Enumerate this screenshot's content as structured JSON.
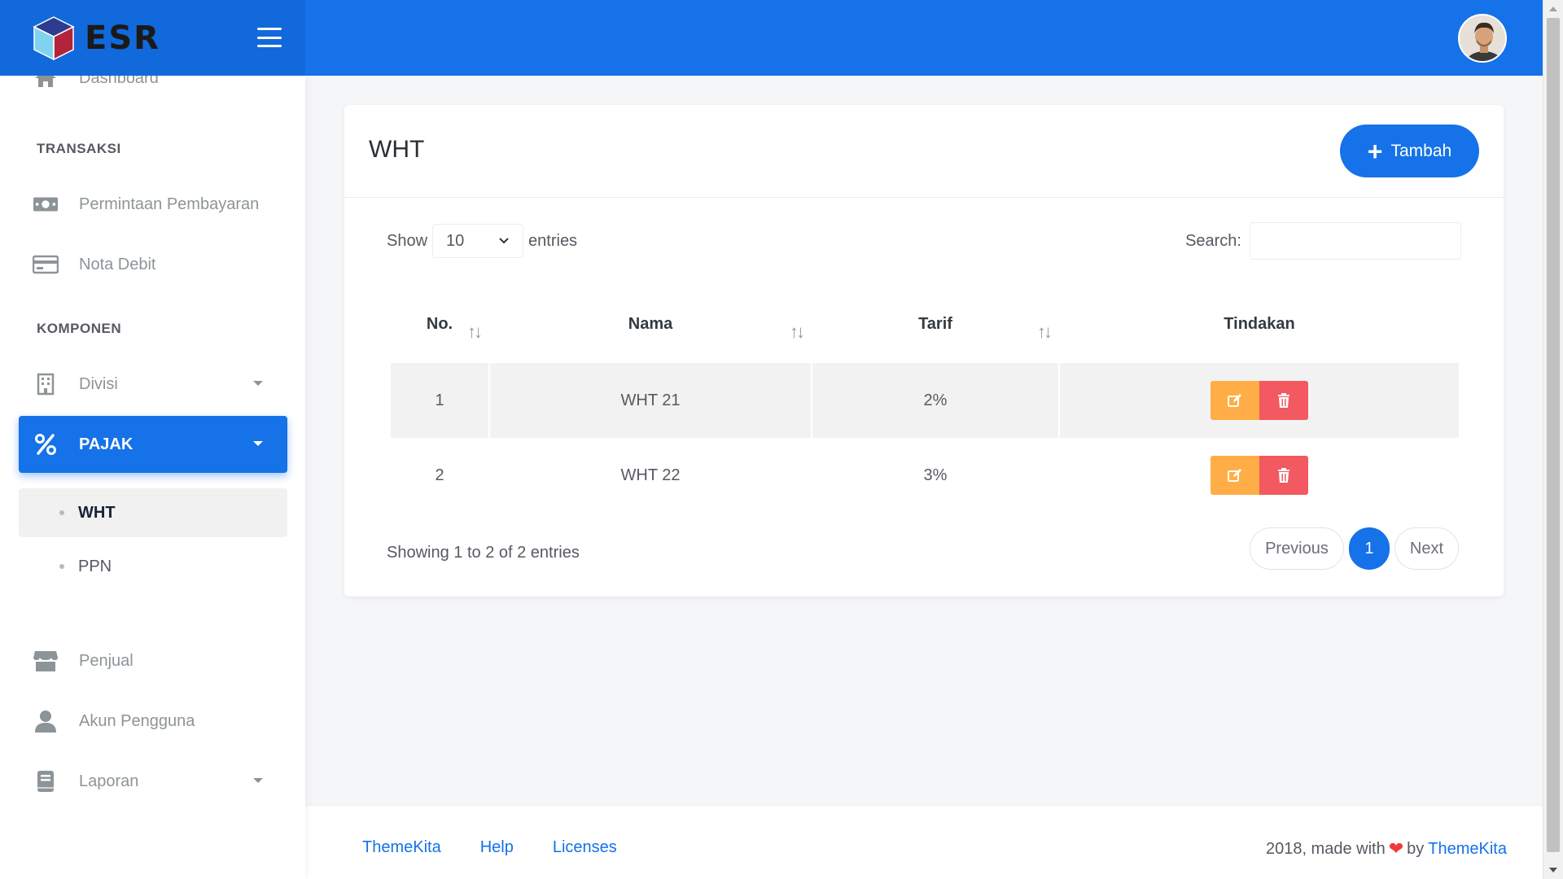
{
  "brand": {
    "name": "ESR"
  },
  "sidebar": {
    "dashboard": "Dashboard",
    "section_transaksi": "TRANSAKSI",
    "permintaan": "Permintaan Pembayaran",
    "nota_debit": "Nota Debit",
    "section_komponen": "KOMPONEN",
    "divisi": "Divisi",
    "pajak": "PAJAK",
    "pajak_sub": [
      "WHT",
      "PPN"
    ],
    "penjual": "Penjual",
    "akun": "Akun Pengguna",
    "laporan": "Laporan"
  },
  "page": {
    "title": "WHT",
    "add_button": "Tambah",
    "show_label": "Show",
    "entries_value": "10",
    "entries_label": "entries",
    "search_label": "Search:",
    "search_value": ""
  },
  "table": {
    "headers": [
      "No.",
      "Nama",
      "Tarif",
      "Tindakan"
    ],
    "rows": [
      {
        "no": "1",
        "nama": "WHT 21",
        "tarif": "2%"
      },
      {
        "no": "2",
        "nama": "WHT 22",
        "tarif": "3%"
      }
    ]
  },
  "pagination": {
    "info": "Showing 1 to 2 of 2 entries",
    "previous": "Previous",
    "current": "1",
    "next": "Next"
  },
  "footer": {
    "links": [
      "ThemeKita",
      "Help",
      "Licenses"
    ],
    "copyright_prefix": "2018, made with",
    "copyright_by": "by",
    "copyright_link": "ThemeKita"
  },
  "colors": {
    "primary": "#1572e8",
    "warning": "#ffad46",
    "danger": "#f25961"
  }
}
